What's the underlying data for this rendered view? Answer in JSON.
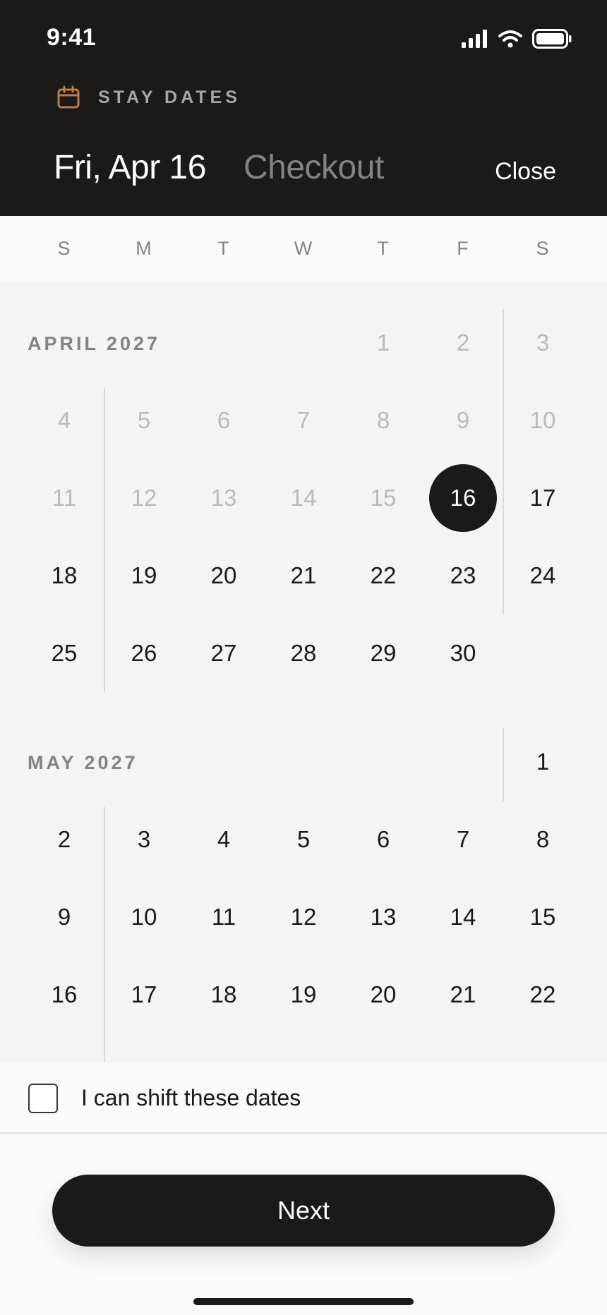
{
  "status_bar": {
    "time": "9:41"
  },
  "header": {
    "section_label": "STAY DATES",
    "checkin_value": "Fri, Apr 16",
    "checkout_placeholder": "Checkout",
    "close_label": "Close",
    "icon": "calendar-icon"
  },
  "weekdays": [
    "S",
    "M",
    "T",
    "W",
    "T",
    "F",
    "S"
  ],
  "months": [
    {
      "title": "APRIL 2027",
      "days": [
        {
          "label": "1",
          "state": "past"
        },
        {
          "label": "2",
          "state": "past"
        },
        {
          "label": "3",
          "state": "past"
        },
        {
          "label": "4",
          "state": "past"
        },
        {
          "label": "5",
          "state": "past"
        },
        {
          "label": "6",
          "state": "past"
        },
        {
          "label": "7",
          "state": "past"
        },
        {
          "label": "8",
          "state": "past"
        },
        {
          "label": "9",
          "state": "past"
        },
        {
          "label": "10",
          "state": "past"
        },
        {
          "label": "11",
          "state": "past"
        },
        {
          "label": "12",
          "state": "past"
        },
        {
          "label": "13",
          "state": "past"
        },
        {
          "label": "14",
          "state": "past"
        },
        {
          "label": "15",
          "state": "past"
        },
        {
          "label": "16",
          "state": "selected"
        },
        {
          "label": "17",
          "state": "available"
        },
        {
          "label": "18",
          "state": "available"
        },
        {
          "label": "19",
          "state": "available"
        },
        {
          "label": "20",
          "state": "available"
        },
        {
          "label": "21",
          "state": "available"
        },
        {
          "label": "22",
          "state": "available"
        },
        {
          "label": "23",
          "state": "available"
        },
        {
          "label": "24",
          "state": "available"
        },
        {
          "label": "25",
          "state": "available"
        },
        {
          "label": "26",
          "state": "available"
        },
        {
          "label": "27",
          "state": "available"
        },
        {
          "label": "28",
          "state": "available"
        },
        {
          "label": "29",
          "state": "available"
        },
        {
          "label": "30",
          "state": "available"
        }
      ]
    },
    {
      "title": "MAY 2027",
      "days": [
        {
          "label": "1",
          "state": "available"
        },
        {
          "label": "2",
          "state": "available"
        },
        {
          "label": "3",
          "state": "available"
        },
        {
          "label": "4",
          "state": "available"
        },
        {
          "label": "5",
          "state": "available"
        },
        {
          "label": "6",
          "state": "available"
        },
        {
          "label": "7",
          "state": "available"
        },
        {
          "label": "8",
          "state": "available"
        },
        {
          "label": "9",
          "state": "available"
        },
        {
          "label": "10",
          "state": "available"
        },
        {
          "label": "11",
          "state": "available"
        },
        {
          "label": "12",
          "state": "available"
        },
        {
          "label": "13",
          "state": "available"
        },
        {
          "label": "14",
          "state": "available"
        },
        {
          "label": "15",
          "state": "available"
        },
        {
          "label": "16",
          "state": "available"
        },
        {
          "label": "17",
          "state": "available"
        },
        {
          "label": "18",
          "state": "available"
        },
        {
          "label": "19",
          "state": "available"
        },
        {
          "label": "20",
          "state": "available"
        },
        {
          "label": "21",
          "state": "available"
        },
        {
          "label": "22",
          "state": "available"
        }
      ]
    }
  ],
  "flexible": {
    "label": "I can shift these dates",
    "checked": false
  },
  "primary_action": {
    "label": "Next"
  },
  "colors": {
    "dark": "#1b1a18",
    "accent": "#c07a45",
    "muted": "#86827c",
    "past": "#bdbab4"
  }
}
